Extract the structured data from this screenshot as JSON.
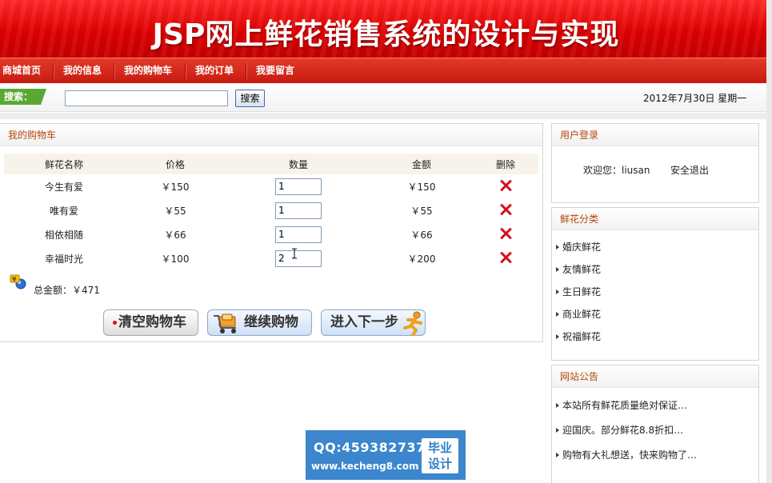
{
  "header": {
    "title_en": "JSP",
    "title_cn": "网上鲜花销售系统的设计与实现"
  },
  "nav": {
    "items": [
      {
        "label": "商城首页"
      },
      {
        "label": "我的信息"
      },
      {
        "label": "我的购物车"
      },
      {
        "label": "我的订单"
      },
      {
        "label": "我要留言"
      }
    ]
  },
  "search": {
    "label": "搜索：",
    "value": "",
    "placeholder": "",
    "button_label": "搜索"
  },
  "date_text": "2012年7月30日 星期一",
  "cart": {
    "title": "我的购物车",
    "columns": [
      "鲜花名称",
      "价格",
      "数量",
      "金额",
      "删除"
    ],
    "rows": [
      {
        "name": "今生有爱",
        "price": "￥150",
        "quantity": "1",
        "amount": "￥150"
      },
      {
        "name": "唯有爱",
        "price": "￥55",
        "quantity": "1",
        "amount": "￥55"
      },
      {
        "name": "相依相随",
        "price": "￥66",
        "quantity": "1",
        "amount": "￥66"
      },
      {
        "name": "幸福时光",
        "price": "￥100",
        "quantity": "2",
        "amount": "￥200"
      }
    ],
    "total_label": "总金额：￥471",
    "buttons": {
      "clear": "清空购物车",
      "continue": "继续购物",
      "next": "进入下一步"
    }
  },
  "login": {
    "title": "用户登录",
    "welcome": "欢迎您：liusan",
    "logout": "安全退出"
  },
  "categories": {
    "title": "鲜花分类",
    "items": [
      "婚庆鲜花",
      "友情鲜花",
      "生日鲜花",
      "商业鲜花",
      "祝福鲜花"
    ]
  },
  "notices": {
    "title": "网站公告",
    "items": [
      "本站所有鲜花质量绝对保证…",
      "迎国庆。部分鲜花8.8折扣…",
      "购物有大礼想送，快来购物了…"
    ]
  },
  "watermark": {
    "qq": "QQ:459382737",
    "url": "www.kecheng8.com",
    "badge_line1": "毕业",
    "badge_line2": "设计"
  },
  "colors": {
    "banner_red": "#e00000",
    "nav_red": "#c81a10",
    "panel_title": "#b5460a",
    "search_label_green": "#5aa832",
    "delete_red": "#d4101a",
    "watermark_blue": "#3b86cc"
  },
  "icons": {
    "delete": "delete-x-icon",
    "total": "money-icon",
    "continue": "shopping-cart-icon",
    "next": "runner-icon"
  }
}
